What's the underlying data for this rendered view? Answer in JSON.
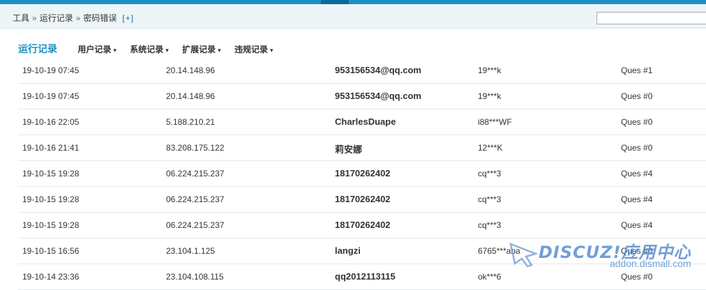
{
  "breadcrumb": {
    "items": [
      "工具",
      "运行记录",
      "密码错误"
    ],
    "separator": "»",
    "add_label": "[+]"
  },
  "search": {
    "value": "",
    "placeholder": ""
  },
  "tabs": {
    "active": "运行记录",
    "menus": [
      "用户记录",
      "系统记录",
      "扩展记录",
      "违规记录"
    ],
    "caret": "▾"
  },
  "rows": [
    {
      "time": "19-10-19 07:45",
      "ip": "20.14.148.96",
      "user": "953156534@qq.com",
      "password": "19***k",
      "question": "Ques #1"
    },
    {
      "time": "19-10-19 07:45",
      "ip": "20.14.148.96",
      "user": "953156534@qq.com",
      "password": "19***k",
      "question": "Ques #0"
    },
    {
      "time": "19-10-16 22:05",
      "ip": "5.188.210.21",
      "user": "CharlesDuape",
      "password": "i88***WF",
      "question": "Ques #0"
    },
    {
      "time": "19-10-16 21:41",
      "ip": "83.208.175.122",
      "user": "莉安娜",
      "password": "12***K",
      "question": "Ques #0"
    },
    {
      "time": "19-10-15 19:28",
      "ip": "06.224.215.237",
      "user": "18170262402",
      "password": "cq***3",
      "question": "Ques #4"
    },
    {
      "time": "19-10-15 19:28",
      "ip": "06.224.215.237",
      "user": "18170262402",
      "password": "cq***3",
      "question": "Ques #4"
    },
    {
      "time": "19-10-15 19:28",
      "ip": "06.224.215.237",
      "user": "18170262402",
      "password": "cq***3",
      "question": "Ques #4"
    },
    {
      "time": "19-10-15 16:56",
      "ip": "23.104.1.125",
      "user": "langzi",
      "password": "6765***aba",
      "question": "Ques #0"
    },
    {
      "time": "19-10-14 23:36",
      "ip": "23.104.108.115",
      "user": "qq2012113115",
      "password": "ok***6",
      "question": "Ques #0"
    }
  ],
  "watermark": {
    "logo": "DISCUZ!应用中心",
    "url": "addon.dismall.com"
  },
  "colors": {
    "accent": "#1e8fc4",
    "accent_dark": "#0b6a99",
    "link": "#2366a8",
    "watermark": "#5a8fd0"
  }
}
